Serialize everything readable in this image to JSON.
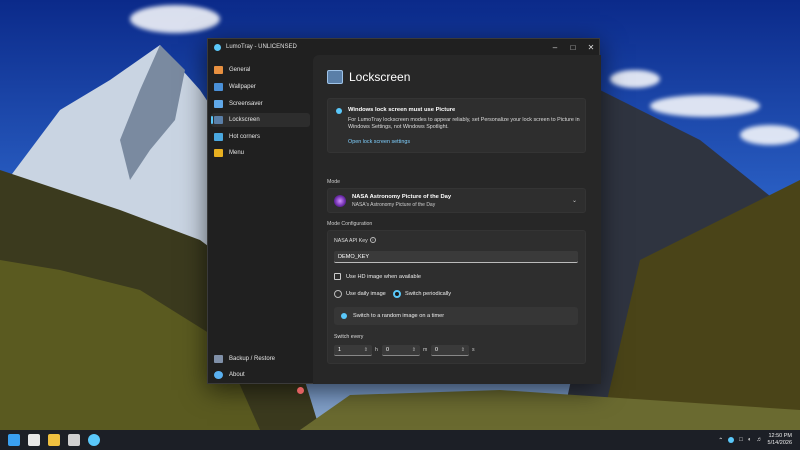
{
  "window": {
    "title": "LumoTray - UNLICENSED"
  },
  "sidebar": {
    "items": [
      {
        "label": "General",
        "color": "#e89040"
      },
      {
        "label": "Wallpaper",
        "color": "#4a90d8"
      },
      {
        "label": "Screensaver",
        "color": "#60a8e8"
      },
      {
        "label": "Lockscreen",
        "color": "#5a7fa8"
      },
      {
        "label": "Hot corners",
        "color": "#4aa8e0"
      },
      {
        "label": "Menu",
        "color": "#e8b020"
      }
    ],
    "footer": [
      {
        "label": "Backup / Restore",
        "color": "#8090a8"
      },
      {
        "label": "About",
        "color": "#5ab0f0"
      }
    ]
  },
  "page": {
    "title": "Lockscreen",
    "info": {
      "title": "Windows lock screen must use Picture",
      "desc": "For LumoTray lockscreen modes to appear reliably, set Personalize your lock screen to Picture in Windows Settings, not Windows Spotlight.",
      "link": "Open lock screen settings"
    },
    "mode_label": "Mode",
    "mode": {
      "title": "NASA Astronomy Picture of the Day",
      "subtitle": "NASA's Astronomy Picture of the Day"
    },
    "config_label": "Mode Configuration",
    "config": {
      "api_key_label": "NASA API Key",
      "api_key_value": "DEMO_KEY",
      "hd_label": "Use HD image when available",
      "radio_daily": "Use daily image",
      "radio_periodic": "Switch periodically",
      "random_label": "Switch to a random image on a timer",
      "switch_every_label": "Switch every",
      "hours": "1",
      "h": "h",
      "minutes": "0",
      "m": "m",
      "seconds": "0",
      "s": "s"
    }
  },
  "clock": {
    "time": "12:50 PM",
    "date": "5/14/2026"
  },
  "accent": "#5ac8fa"
}
